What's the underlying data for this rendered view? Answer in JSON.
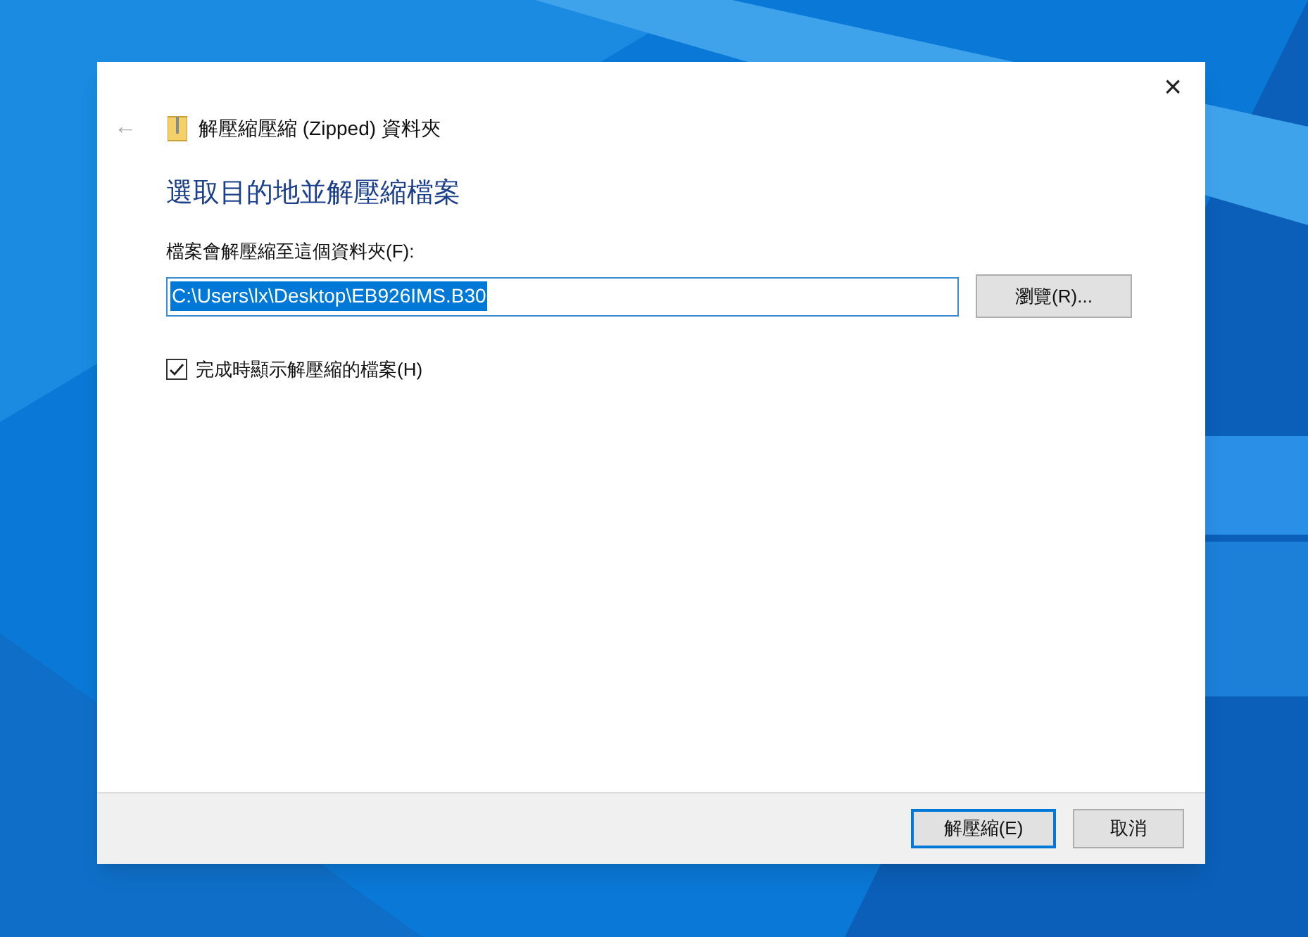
{
  "window": {
    "title": "解壓縮壓縮 (Zipped) 資料夾",
    "close": "×",
    "back": "←"
  },
  "heading": "選取目的地並解壓縮檔案",
  "destination": {
    "label": "檔案會解壓縮至這個資料夾(F):",
    "value": "C:\\Users\\lx\\Desktop\\EB926IMS.B30",
    "text_selected": true,
    "browse": "瀏覽(R)..."
  },
  "show_files": {
    "label": "完成時顯示解壓縮的檔案(H)",
    "checked": true
  },
  "buttons": [
    {
      "label": "解壓縮(E)",
      "default": true
    },
    {
      "label": "取消",
      "default": false
    }
  ]
}
